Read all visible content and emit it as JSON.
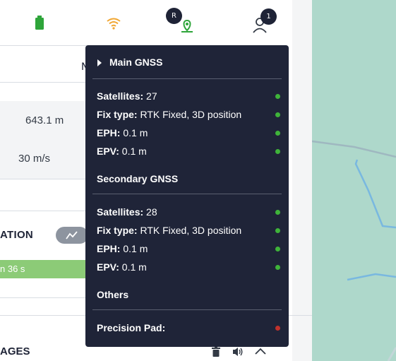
{
  "toolbar": {
    "battery_icon": "battery-icon",
    "wifi_icon": "wifi-icon",
    "rtk_badge": "R",
    "notifications_count": "1",
    "colors": {
      "battery": "#2ea53a",
      "wifi": "#f1a733",
      "rtk_pin": "#2ea53a"
    }
  },
  "telemetry": {
    "tab_partial": "N",
    "altitude": "643.1 m",
    "speed": "30 m/s"
  },
  "mission": {
    "title_partial": "ATION",
    "progress_text": "n  36 s",
    "progress_color": "#8ccb77"
  },
  "messages": {
    "title_partial": "AGES"
  },
  "gnss_popup": {
    "main_title": "Main GNSS",
    "main": [
      {
        "label": "Satellites:",
        "value": " 27",
        "status": "ok"
      },
      {
        "label": "Fix type:",
        "value": " RTK Fixed, 3D position",
        "status": "ok"
      },
      {
        "label": "EPH:",
        "value": " 0.1 m",
        "status": "ok"
      },
      {
        "label": "EPV:",
        "value": " 0.1 m",
        "status": "ok"
      }
    ],
    "secondary_title": "Secondary GNSS",
    "secondary": [
      {
        "label": "Satellites:",
        "value": " 28",
        "status": "ok"
      },
      {
        "label": "Fix type:",
        "value": " RTK Fixed, 3D position",
        "status": "ok"
      },
      {
        "label": "EPH:",
        "value": " 0.1 m",
        "status": "ok"
      },
      {
        "label": "EPV:",
        "value": " 0.1 m",
        "status": "ok"
      }
    ],
    "others_title": "Others",
    "others": [
      {
        "label": "Precision Pad:",
        "value": "",
        "status": "error"
      }
    ],
    "status_colors": {
      "ok": "#3fb43a",
      "error": "#c0322c"
    }
  }
}
